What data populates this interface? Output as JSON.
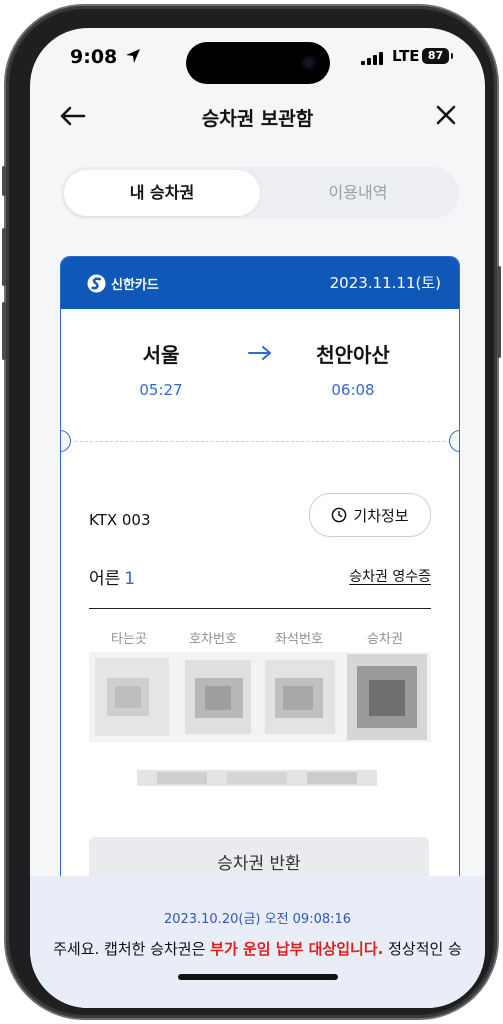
{
  "status_bar": {
    "time": "9:08",
    "network": "LTE",
    "battery": "87"
  },
  "header": {
    "title": "승차권 보관함"
  },
  "tabs": [
    {
      "label": "내 승차권",
      "active": true
    },
    {
      "label": "이용내역",
      "active": false
    }
  ],
  "ticket": {
    "card_brand": "신한카드",
    "date": "2023.11.11(토)",
    "departure": {
      "station": "서울",
      "time": "05:27"
    },
    "arrival": {
      "station": "천안아산",
      "time": "06:08"
    },
    "train": "KTX 003",
    "train_info_label": "기차정보",
    "passenger_label": "어른",
    "passenger_count": "1",
    "receipt_label": "승차권 영수증",
    "columns": [
      "타는곳",
      "호차번호",
      "좌석번호",
      "승차권"
    ],
    "refund_label": "승차권 반환"
  },
  "bottom": {
    "timestamp": "2023.10.20(금) 오전 09:08:16",
    "notice_prefix": "주세요. 캡처한 승차권은 ",
    "notice_warning": "부가 운임 납부 대상입니다.",
    "notice_suffix": " 정상적인 승"
  },
  "colors": {
    "accent": "#0f58b8",
    "link_blue": "#3267d6",
    "warning_red": "#e0201b"
  }
}
